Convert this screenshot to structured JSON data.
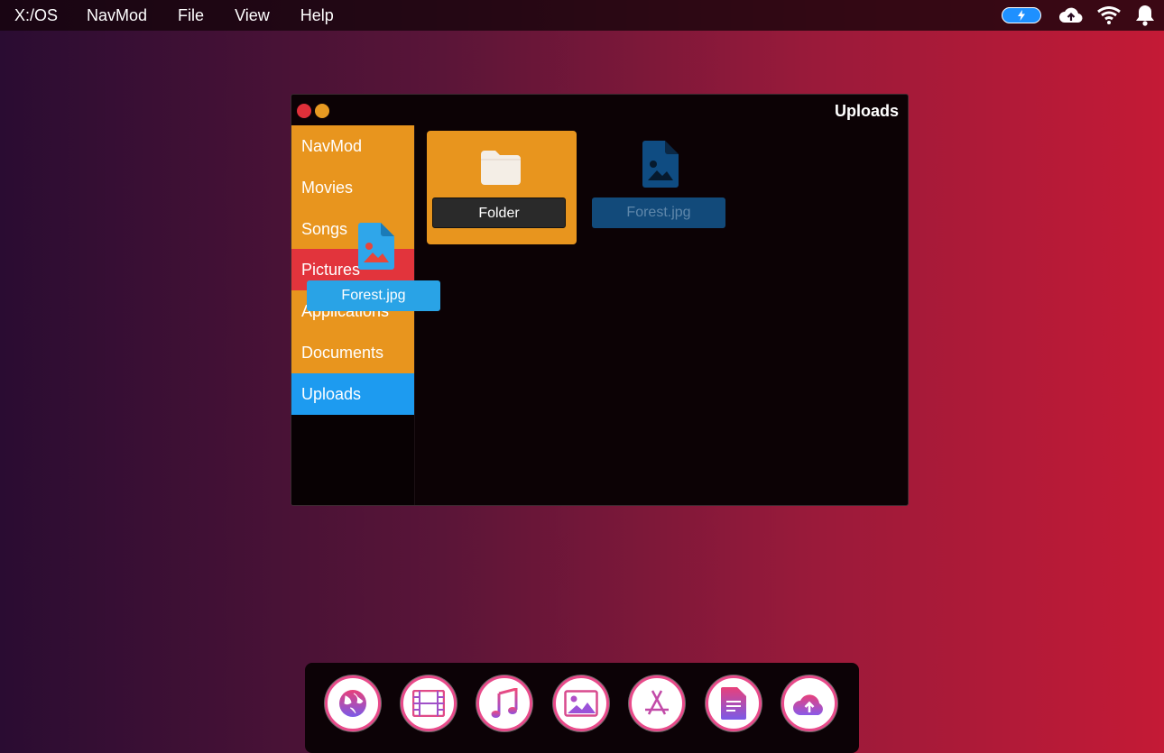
{
  "menubar": {
    "items": [
      "X:/OS",
      "NavMod",
      "File",
      "View",
      "Help"
    ]
  },
  "status_icons": [
    "battery-charging-icon",
    "cloud-upload-icon",
    "wifi-icon",
    "bell-icon"
  ],
  "window": {
    "title": "Uploads",
    "sidebar": [
      "NavMod",
      "Movies",
      "Songs",
      "Pictures",
      "Applications",
      "Documents",
      "Uploads"
    ],
    "selected": "Uploads",
    "drop_target": "Pictures",
    "items": [
      {
        "label": "Folder",
        "icon": "folder-icon"
      },
      {
        "label": "Forest.jpg",
        "icon": "image-file-icon"
      }
    ]
  },
  "drag": {
    "label": "Forest.jpg",
    "icon": "image-file-icon"
  },
  "dock": [
    "globe-icon",
    "film-icon",
    "music-icon",
    "picture-icon",
    "app-store-icon",
    "document-icon",
    "cloud-upload-icon"
  ],
  "colors": {
    "accent_orange": "#e8951e",
    "accent_blue": "#1d9bf0",
    "accent_red": "#e2343c"
  }
}
